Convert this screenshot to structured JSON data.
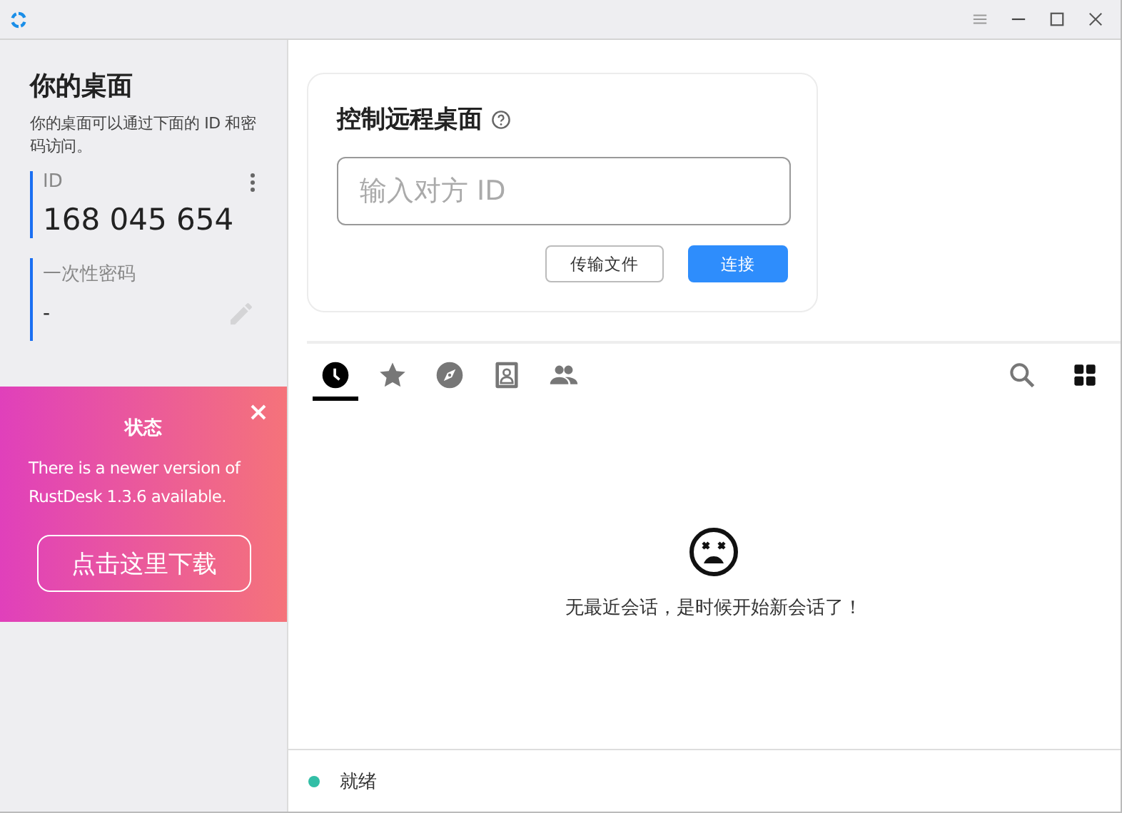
{
  "sidebar": {
    "title": "你的桌面",
    "description": "你的桌面可以通过下面的 ID 和密码访问。",
    "id_label": "ID",
    "id_value": "168 045 654",
    "password_label": "一次性密码",
    "password_value": "-"
  },
  "update_banner": {
    "title": "状态",
    "message": "There is a newer version of RustDesk 1.3.6 available.",
    "button": "点击这里下载"
  },
  "connect_card": {
    "title": "控制远程桌面",
    "input": {
      "placeholder": "输入对方 ID"
    },
    "buttons": [
      {
        "label": "传输文件",
        "kind": "secondary"
      },
      {
        "label": "连接",
        "kind": "primary"
      }
    ]
  },
  "tabs": [
    {
      "kind": "recent",
      "selected": true
    },
    {
      "kind": "favorites",
      "selected": false
    },
    {
      "kind": "discovered",
      "selected": false
    },
    {
      "kind": "address-book",
      "selected": false
    },
    {
      "kind": "group",
      "selected": false
    }
  ],
  "empty_message": "无最近会话，是时候开始新会话了！",
  "status_bar": {
    "text": "就绪",
    "color": "#32bea6"
  }
}
